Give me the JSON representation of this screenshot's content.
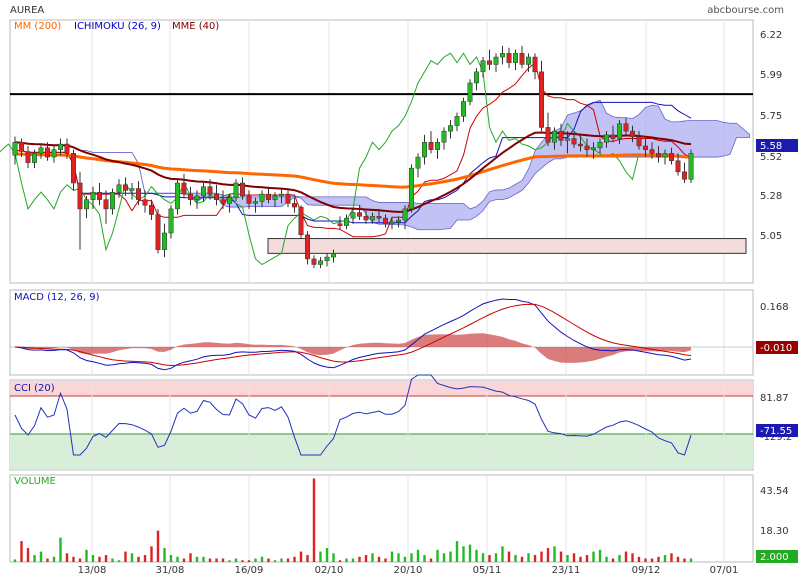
{
  "header": {
    "ticker": "AUREA",
    "source": "abcbourse.com"
  },
  "price_panel": {
    "legend": [
      {
        "label": "MM (200)",
        "color": "#ff6600"
      },
      {
        "label": "ICHIMOKU (26, 9)",
        "color": "#0000cc"
      },
      {
        "label": "MME (40)",
        "color": "#800000"
      }
    ],
    "y_ticks": [
      "6.22",
      "5.99",
      "5.75",
      "5.52",
      "5.28",
      "5.05"
    ],
    "y_range": [
      4.88,
      6.3
    ],
    "last_value": "5.58",
    "horizontal_line": 5.9,
    "zone": {
      "low": 5.04,
      "high": 5.12
    }
  },
  "macd_panel": {
    "label": "MACD (12, 26, 9)",
    "y_ticks": [
      "0.168"
    ],
    "last_value": "-0.010"
  },
  "cci_panel": {
    "label": "CCI (20)",
    "y_ticks": [
      "81.87",
      "-129.2"
    ],
    "last_value": "-71.55"
  },
  "volume_panel": {
    "label": "VOLUME",
    "y_ticks": [
      "43.54",
      "18.30"
    ],
    "last_value": "2.000"
  },
  "x_ticks": [
    "13/08",
    "31/08",
    "16/09",
    "02/10",
    "20/10",
    "05/11",
    "23/11",
    "09/12",
    "07/01"
  ],
  "colors": {
    "up": "#22bb22",
    "down": "#dd2222",
    "ichimoku": "#1111bb",
    "tenkan": "#cc0000",
    "chikou": "#22aa22",
    "ema40": "#800000",
    "ma200": "#ff6600",
    "cloud": "#9999ee",
    "macd": "#1111bb",
    "signal": "#cc0000",
    "hist": "#cc4444",
    "cci": "#2233bb"
  },
  "chart_data": [
    {
      "type": "candlestick",
      "title": "AUREA",
      "series": [
        {
          "name": "MM (200)"
        },
        {
          "name": "ICHIMOKU (26, 9)"
        },
        {
          "name": "MME (40)"
        }
      ],
      "ohlc": [
        [
          5.57,
          5.67,
          5.52,
          5.64
        ],
        [
          5.64,
          5.66,
          5.56,
          5.59
        ],
        [
          5.59,
          5.62,
          5.5,
          5.53
        ],
        [
          5.53,
          5.6,
          5.5,
          5.58
        ],
        [
          5.58,
          5.63,
          5.55,
          5.61
        ],
        [
          5.61,
          5.64,
          5.54,
          5.56
        ],
        [
          5.56,
          5.62,
          5.53,
          5.6
        ],
        [
          5.6,
          5.66,
          5.57,
          5.63
        ],
        [
          5.63,
          5.66,
          5.55,
          5.58
        ],
        [
          5.58,
          5.6,
          5.38,
          5.42
        ],
        [
          5.42,
          5.48,
          5.06,
          5.28
        ],
        [
          5.28,
          5.35,
          5.23,
          5.33
        ],
        [
          5.33,
          5.4,
          5.28,
          5.37
        ],
        [
          5.37,
          5.42,
          5.3,
          5.33
        ],
        [
          5.33,
          5.38,
          5.2,
          5.28
        ],
        [
          5.28,
          5.39,
          5.25,
          5.37
        ],
        [
          5.37,
          5.44,
          5.34,
          5.41
        ],
        [
          5.41,
          5.45,
          5.35,
          5.38
        ],
        [
          5.38,
          5.42,
          5.33,
          5.39
        ],
        [
          5.39,
          5.43,
          5.3,
          5.33
        ],
        [
          5.33,
          5.38,
          5.26,
          5.3
        ],
        [
          5.3,
          5.33,
          5.22,
          5.25
        ],
        [
          5.25,
          5.28,
          5.04,
          5.06
        ],
        [
          5.06,
          5.2,
          5.02,
          5.15
        ],
        [
          5.15,
          5.3,
          5.12,
          5.28
        ],
        [
          5.28,
          5.44,
          5.25,
          5.42
        ],
        [
          5.42,
          5.47,
          5.34,
          5.36
        ],
        [
          5.36,
          5.4,
          5.3,
          5.33
        ],
        [
          5.33,
          5.38,
          5.28,
          5.35
        ],
        [
          5.35,
          5.42,
          5.32,
          5.4
        ],
        [
          5.4,
          5.44,
          5.33,
          5.36
        ],
        [
          5.36,
          5.41,
          5.3,
          5.33
        ],
        [
          5.33,
          5.38,
          5.28,
          5.31
        ],
        [
          5.31,
          5.36,
          5.26,
          5.34
        ],
        [
          5.34,
          5.44,
          5.32,
          5.42
        ],
        [
          5.42,
          5.45,
          5.33,
          5.35
        ],
        [
          5.35,
          5.38,
          5.28,
          5.31
        ],
        [
          5.31,
          5.34,
          5.26,
          5.32
        ],
        [
          5.32,
          5.38,
          5.29,
          5.36
        ],
        [
          5.36,
          5.4,
          5.31,
          5.33
        ],
        [
          5.33,
          5.37,
          5.29,
          5.35
        ],
        [
          5.35,
          5.39,
          5.31,
          5.36
        ],
        [
          5.36,
          5.38,
          5.29,
          5.31
        ],
        [
          5.31,
          5.34,
          5.26,
          5.29
        ],
        [
          5.29,
          5.3,
          5.12,
          5.14
        ],
        [
          5.14,
          5.16,
          4.98,
          5.01
        ],
        [
          5.01,
          5.03,
          4.96,
          4.98
        ],
        [
          4.98,
          5.02,
          4.96,
          5.0
        ],
        [
          5.0,
          5.04,
          4.97,
          5.02
        ],
        [
          5.02,
          5.06,
          4.99,
          5.04
        ],
        [
          5.2,
          5.24,
          5.17,
          5.19
        ],
        [
          5.19,
          5.25,
          5.17,
          5.23
        ],
        [
          5.23,
          5.28,
          5.2,
          5.26
        ],
        [
          5.26,
          5.3,
          5.22,
          5.24
        ],
        [
          5.24,
          5.27,
          5.2,
          5.22
        ],
        [
          5.22,
          5.26,
          5.2,
          5.24
        ],
        [
          5.24,
          5.28,
          5.21,
          5.23
        ],
        [
          5.23,
          5.25,
          5.18,
          5.2
        ],
        [
          5.2,
          5.23,
          5.17,
          5.21
        ],
        [
          5.21,
          5.24,
          5.18,
          5.22
        ],
        [
          5.22,
          5.3,
          5.17,
          5.28
        ],
        [
          5.28,
          5.52,
          5.26,
          5.5
        ],
        [
          5.5,
          5.58,
          5.45,
          5.56
        ],
        [
          5.56,
          5.68,
          5.52,
          5.64
        ],
        [
          5.64,
          5.7,
          5.58,
          5.6
        ],
        [
          5.6,
          5.66,
          5.55,
          5.64
        ],
        [
          5.64,
          5.72,
          5.6,
          5.7
        ],
        [
          5.7,
          5.76,
          5.66,
          5.73
        ],
        [
          5.73,
          5.8,
          5.7,
          5.78
        ],
        [
          5.78,
          5.88,
          5.75,
          5.86
        ],
        [
          5.86,
          5.98,
          5.84,
          5.96
        ],
        [
          5.96,
          6.04,
          5.92,
          6.02
        ],
        [
          6.02,
          6.1,
          5.99,
          6.08
        ],
        [
          6.08,
          6.14,
          6.03,
          6.06
        ],
        [
          6.06,
          6.12,
          6.02,
          6.1
        ],
        [
          6.1,
          6.16,
          6.06,
          6.12
        ],
        [
          6.12,
          6.15,
          6.04,
          6.07
        ],
        [
          6.07,
          6.14,
          6.03,
          6.12
        ],
        [
          6.12,
          6.16,
          6.04,
          6.06
        ],
        [
          6.06,
          6.12,
          6.02,
          6.1
        ],
        [
          6.1,
          6.12,
          5.98,
          6.02
        ],
        [
          6.02,
          6.08,
          5.7,
          5.72
        ],
        [
          5.72,
          5.8,
          5.62,
          5.64
        ],
        [
          5.64,
          5.72,
          5.6,
          5.7
        ],
        [
          5.7,
          5.74,
          5.62,
          5.65
        ],
        [
          5.65,
          5.7,
          5.58,
          5.66
        ],
        [
          5.66,
          5.7,
          5.61,
          5.63
        ],
        [
          5.63,
          5.68,
          5.59,
          5.62
        ],
        [
          5.62,
          5.66,
          5.56,
          5.6
        ],
        [
          5.6,
          5.64,
          5.55,
          5.61
        ],
        [
          5.61,
          5.66,
          5.58,
          5.64
        ],
        [
          5.64,
          5.7,
          5.61,
          5.68
        ],
        [
          5.68,
          5.73,
          5.64,
          5.66
        ],
        [
          5.66,
          5.76,
          5.63,
          5.74
        ],
        [
          5.74,
          5.77,
          5.68,
          5.7
        ],
        [
          5.7,
          5.73,
          5.64,
          5.67
        ],
        [
          5.67,
          5.7,
          5.6,
          5.62
        ],
        [
          5.62,
          5.66,
          5.56,
          5.6
        ],
        [
          5.6,
          5.64,
          5.55,
          5.58
        ],
        [
          5.58,
          5.62,
          5.53,
          5.56
        ],
        [
          5.56,
          5.6,
          5.52,
          5.58
        ],
        [
          5.58,
          5.61,
          5.52,
          5.54
        ],
        [
          5.54,
          5.58,
          5.46,
          5.48
        ],
        [
          5.48,
          5.53,
          5.42,
          5.44
        ],
        [
          5.44,
          5.6,
          5.42,
          5.58
        ]
      ]
    },
    {
      "type": "line",
      "title": "MACD (12, 26, 9)",
      "series": [
        {
          "name": "MACD (12, 26, 9)"
        }
      ],
      "last": -0.01
    },
    {
      "type": "line",
      "title": "CCI (20)",
      "series": [
        {
          "name": "CCI (20)"
        }
      ],
      "last": -71.55
    },
    {
      "type": "bar",
      "title": "VOLUME",
      "ylim": [
        0,
        50
      ],
      "values": [
        1.5,
        12,
        8,
        4,
        6,
        2,
        3,
        14,
        5,
        3,
        2,
        7,
        4,
        3,
        4,
        2,
        1,
        6,
        5,
        3,
        4,
        9,
        18,
        8,
        4,
        3,
        2,
        5,
        3,
        3,
        2,
        2,
        2,
        1,
        2,
        1,
        1,
        2,
        3,
        2,
        1,
        2,
        2,
        3,
        6,
        4,
        48,
        6,
        8,
        5,
        1,
        2,
        2,
        3,
        4,
        5,
        3,
        2,
        6,
        5,
        3,
        5,
        7,
        4,
        2,
        7,
        5,
        6,
        12,
        9,
        10,
        7,
        5,
        4,
        5,
        9,
        6,
        4,
        3,
        5,
        4,
        6,
        8,
        9,
        6,
        4,
        5,
        3,
        4,
        6,
        7,
        3,
        2,
        4,
        6,
        5,
        3,
        2,
        2,
        3,
        4,
        5,
        3,
        2,
        2
      ]
    }
  ]
}
